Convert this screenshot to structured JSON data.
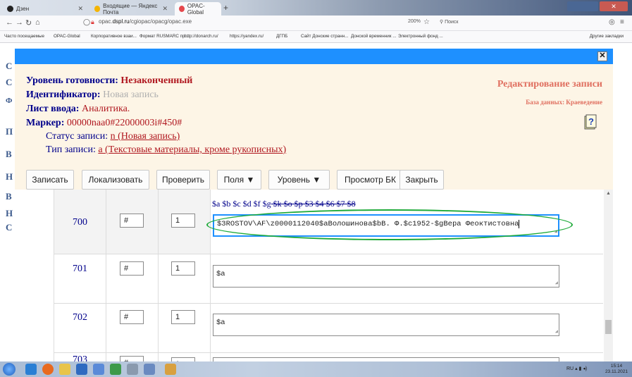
{
  "browser": {
    "tabs": [
      {
        "label": "Дзен",
        "favicon_color": "#222222"
      },
      {
        "label": "Входящие — Яндекс Почта",
        "favicon_color": "#f4b400"
      },
      {
        "label": "OPAC-Global",
        "favicon_color": "#e5484d"
      }
    ],
    "new_tab": "+",
    "window_close": "✕",
    "url_prefix": "opac.",
    "url_domain": "dspl.ru",
    "url_path": "/cgiopac/opacg/opac.exe",
    "zoom": "200%",
    "search_placeholder": "Поиск",
    "bookmarks": [
      "Часто посещаемые",
      "OPAC-Global",
      "Корпоративное взаи...",
      "Формат RUSMARC пр...",
      "http://donarch.ru/",
      "https://yandex.ru/",
      "ДГПБ",
      "Сайт Донские странн...",
      "Донской временник ...",
      "Электронный фонд ..."
    ],
    "bookmarks_other": "Другие закладки"
  },
  "page_bg_letters": [
    "С",
    "С",
    "Ф",
    "П",
    "В",
    "Н",
    "В",
    "Н",
    "С"
  ],
  "modal": {
    "close": "✕",
    "readiness_label": "Уровень готовности:",
    "readiness_value": "Незаконченный",
    "id_label": "Идентификатор:",
    "id_value": "Новая запись",
    "sheet_label": "Лист ввода:",
    "sheet_value": "Аналитика.",
    "marker_label": "Маркер:",
    "marker_value": "00000naa0#22000003i#450#",
    "status_label": "Статус записи:",
    "status_value": "n (Новая запись)",
    "type_label": "Тип записи:",
    "type_value": "a (Текстовые материалы, кроме рукописных)",
    "edit_title": "Редактирование записи",
    "database": "База данных: Краеведение",
    "help_icon": "help-icon"
  },
  "toolbar": {
    "save": "Записать",
    "localize": "Локализовать",
    "check": "Проверить",
    "fields": "Поля ▼",
    "level": "Уровень ▼",
    "preview": "Просмотр БК",
    "close": "Закрыть"
  },
  "grid": {
    "rows": [
      {
        "tag": "700",
        "ind1": "#",
        "ind2": "1",
        "subfield_plain": "$a $b $c $d $f $g",
        "subfield_struck": " $k $o $p $3 $4 $6 $7 $8",
        "value": "$3ROSTOV\\AF\\z0000112040$aВолошинова$bВ. Ф.$c1952-$gВера Феоктистовна"
      },
      {
        "tag": "701",
        "ind1": "#",
        "ind2": "1",
        "value": "$a"
      },
      {
        "tag": "702",
        "ind1": "#",
        "ind2": "1",
        "value": "$a"
      },
      {
        "tag": "703",
        "ind1": "#",
        "ind2": "1",
        "value": "$"
      }
    ]
  },
  "taskbar": {
    "lang": "RU",
    "time": "15:14",
    "date": "23.11.2021"
  }
}
